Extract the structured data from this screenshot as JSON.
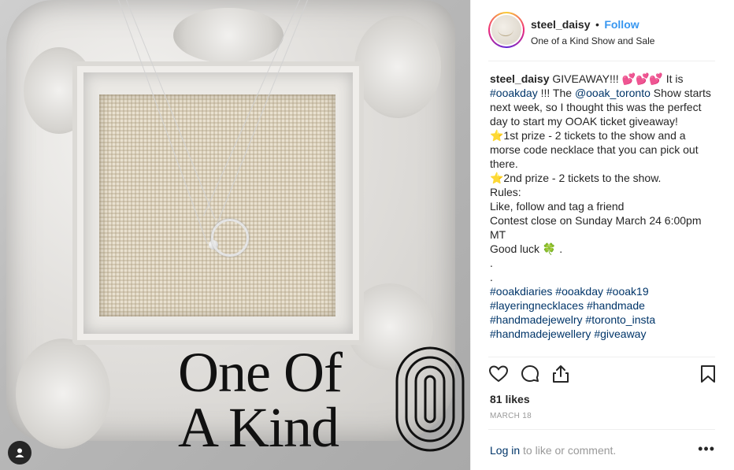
{
  "image": {
    "overlay_line1": "One Of",
    "overlay_line2": "A Kind"
  },
  "post_header": {
    "username": "steel_daisy",
    "separator": "•",
    "follow_label": "Follow",
    "location": "One of a Kind Show and Sale"
  },
  "caption": {
    "username": "steel_daisy",
    "line1": " GIVEAWAY!!! 💕💕💕 It is ",
    "tag_ooakday": "#ooakday",
    "line2": " !!! The ",
    "mention": "@ooak_toronto",
    "line3": " Show starts next week, so I thought this was the perfect day to start my OOAK ticket giveaway!",
    "prize1": "⭐1st prize - 2 tickets to the show and a morse code necklace that you can pick out there.",
    "prize2": "⭐2nd prize - 2 tickets to the show.",
    "rules_title": "Rules:",
    "rules1": "Like, follow and tag a friend",
    "rules2": "Contest close on Sunday March 24 6:00pm MT",
    "goodluck": "Good luck 🍀 .",
    "dot1": ".",
    "dot2": ".",
    "hashtags": [
      "#ooakdiaries",
      "#ooakday",
      "#ooak19",
      "#layeringnecklaces",
      "#handmade",
      "#handmadejewelry",
      "#toronto_insta",
      "#handmadejewellery",
      "#giveaway"
    ]
  },
  "icons": {
    "like": "heart-icon",
    "comment": "comment-icon",
    "share": "share-icon",
    "save": "bookmark-icon",
    "more": "more-icon"
  },
  "stats": {
    "likes": "81 likes",
    "date": "MARCH 18"
  },
  "footer": {
    "login_label": "Log in",
    "comment_text": " to like or comment.",
    "more_label": "•••"
  }
}
